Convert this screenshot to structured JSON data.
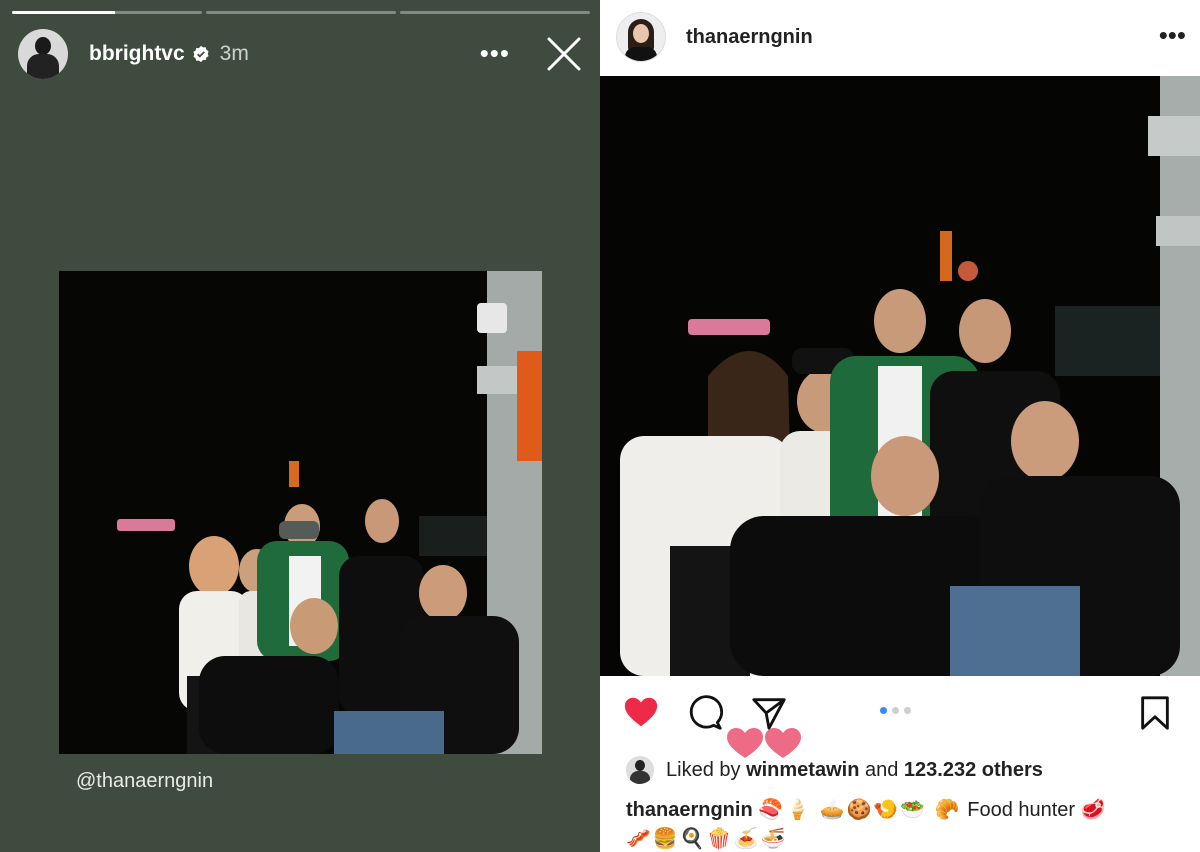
{
  "story": {
    "username": "bbrightvc",
    "time": "3m",
    "more_label": "•••",
    "progress_segments": [
      1.0,
      0.0,
      0.0
    ],
    "progress_current": 0.5,
    "mention": "@thanaerngnin",
    "background_color": "#3f4b3f"
  },
  "post": {
    "username": "thanaerngnin",
    "more_label": "•••",
    "carousel": {
      "count": 3,
      "active_index": 0
    },
    "liked_prefix": "Liked by ",
    "liked_user": "winmetawin",
    "liked_mid": " and ",
    "liked_count": "123.232 others",
    "caption_user": "thanaerngnin",
    "caption_emojis_1": "🍣🍦 🥧🍪🍤🥗 🥐",
    "caption_text": " Food hunter ",
    "caption_emojis_2": "🥩",
    "caption_emojis_line2": "🥓🍔🍳🍿🍝🍜",
    "like_color": "#ed2b48",
    "carousel_active_color": "#2f8ff0"
  },
  "icons": [
    "verified-badge-icon",
    "more-icon",
    "close-icon",
    "heart-icon",
    "comment-icon",
    "share-icon",
    "bookmark-icon"
  ]
}
